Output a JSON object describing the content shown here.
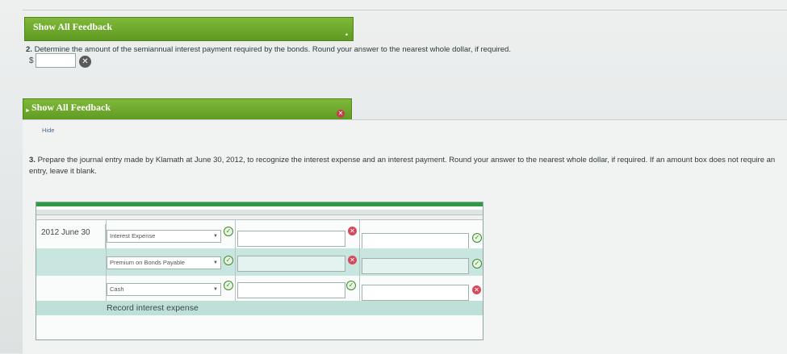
{
  "feedback1": {
    "label": "Show All Feedback",
    "toggle": "•"
  },
  "q2": {
    "number": "2.",
    "text": "Determine the amount of the semiannual interest payment required by the bonds. Round your answer to the nearest whole dollar, if required.",
    "currency": "$",
    "value": ""
  },
  "feedback2": {
    "label": "Show All Feedback"
  },
  "hide_link": "Hide",
  "q3": {
    "number": "3.",
    "text": "Prepare the journal entry made by Klamath at June 30, 2012, to recognize the interest expense and an interest payment. Round your answer to the nearest whole dollar, if required. If an amount box does not require an entry, leave it blank."
  },
  "journal": {
    "date": "2012 June 30",
    "rows": [
      {
        "account": "Interest Expense",
        "debit": "",
        "credit": "",
        "account_status": "correct",
        "debit_status": "incorrect",
        "credit_status": "correct"
      },
      {
        "account": "Premium on Bonds Payable",
        "debit": "",
        "credit": "",
        "account_status": "correct",
        "debit_status": "incorrect",
        "credit_status": "correct"
      },
      {
        "account": "Cash",
        "debit": "",
        "credit": "",
        "account_status": "correct",
        "debit_status": "correct",
        "credit_status": "incorrect"
      }
    ],
    "explanation": "Record interest expense"
  },
  "icons": {
    "correct": "✓",
    "incorrect": "✕"
  },
  "colors": {
    "feedback_bar": "#6aa42a",
    "journal_accent": "#2f9a46",
    "row_shade": "#c8e6df",
    "error": "#d24a5b",
    "ok": "#3f8a2a"
  }
}
